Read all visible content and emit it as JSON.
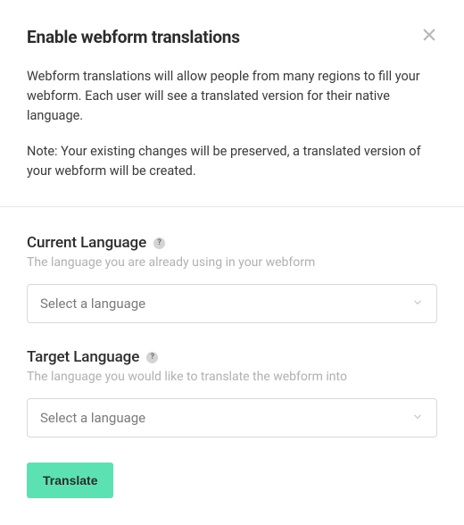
{
  "header": {
    "title": "Enable webform translations",
    "description": "Webform translations will allow people from many regions to fill your webform. Each user will see a translated version for their native language.",
    "note": "Note: Your existing changes will be preserved, a translated version of your webform will be created."
  },
  "form": {
    "currentLanguage": {
      "label": "Current Language",
      "helpText": "?",
      "description": "The language you are already using in your webform",
      "placeholder": "Select a language"
    },
    "targetLanguage": {
      "label": "Target Language",
      "helpText": "?",
      "description": "The language you would like to translate the webform into",
      "placeholder": "Select a language"
    },
    "submitLabel": "Translate"
  }
}
